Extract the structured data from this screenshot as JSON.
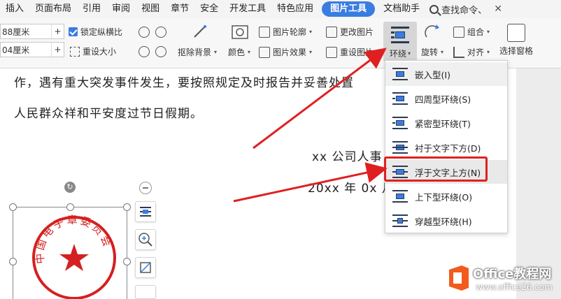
{
  "menu": {
    "items": [
      "插入",
      "页面布局",
      "引用",
      "审阅",
      "视图",
      "章节",
      "安全",
      "开发工具",
      "特色应用",
      "图片工具",
      "文档助手"
    ],
    "active_label": "图片工具",
    "search_label": "查找命令、",
    "close_glyph": "✕"
  },
  "ribbon": {
    "height_value": "88厘米",
    "width_value": "04厘米",
    "plus": "+",
    "lock_ratio": "锁定纵横比",
    "reset_size": "重设大小",
    "remove_bg": "抠除背景",
    "color": "颜色",
    "outline": "图片轮廓",
    "effects": "图片效果",
    "change_pic": "更改图片",
    "reset_pic": "重设图片",
    "wrap": "环绕",
    "rotate": "旋转",
    "group": "组合",
    "align": "对齐",
    "selection_pane": "选择窗格",
    "caret": "▾"
  },
  "document": {
    "line1": "作，遇有重大突发事件发生，要按照规定及时报告并妥善处置",
    "line2": "人民群众祥和平安度过节日假期。",
    "line3": "xx 公司人事",
    "line4": "20xx 年 0x 月"
  },
  "seal": {
    "ring_text": "中国电子章委员会"
  },
  "wrap_menu": {
    "items": [
      "嵌入型(I)",
      "四周型环绕(S)",
      "紧密型环绕(T)",
      "衬于文字下方(D)",
      "浮于文字上方(N)",
      "上下型环绕(O)",
      "穿越型环绕(H)"
    ],
    "highlighted_index": 4
  },
  "watermark": {
    "title": "Office教程网",
    "url": "www.office26.com"
  },
  "colors": {
    "accent": "#3a7de0",
    "highlight_border": "#e02020",
    "seal_red": "#d42020"
  }
}
